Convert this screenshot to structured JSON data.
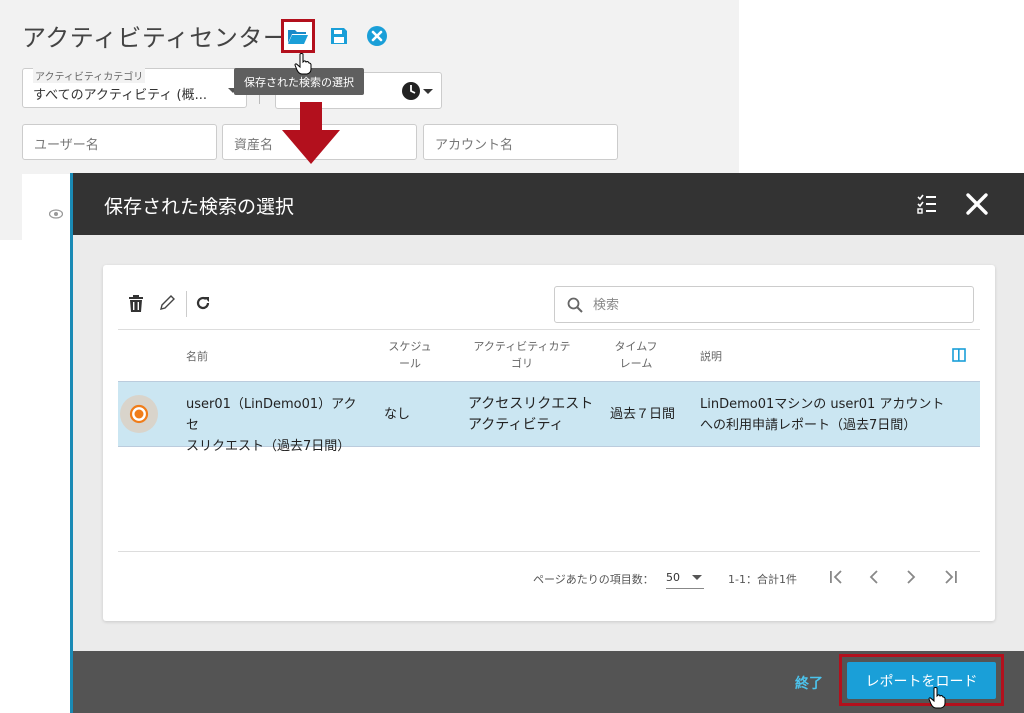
{
  "page": {
    "title": "アクティビティセンター",
    "tooltip": "保存された検索の選択",
    "category_select": {
      "label": "アクティビティカテゴリ",
      "value": "すべてのアクティビティ (概..."
    },
    "filters": {
      "user_placeholder": "ユーザー名",
      "asset_placeholder": "資産名",
      "account_placeholder": "アカウント名"
    },
    "icons": {
      "open": "folder-open-icon",
      "save": "save-icon",
      "clear": "close-circle-icon",
      "time": "clock-icon"
    }
  },
  "modal": {
    "title": "保存された検索の選択",
    "search_placeholder": "検索",
    "columns": {
      "name": "名前",
      "schedule": [
        "スケジュ",
        "ール"
      ],
      "category": [
        "アクティビティカテ",
        "ゴリ"
      ],
      "timeframe": [
        "タイムフ",
        "レーム"
      ],
      "description": "説明"
    },
    "rows": [
      {
        "name": [
          "user01（LinDemo01）アクセ",
          "スリクエスト（過去7日間）"
        ],
        "schedule": "なし",
        "category": [
          "アクセスリクエスト",
          "アクティビティ"
        ],
        "timeframe": "過去７日間",
        "description": [
          "LinDemo01マシンの user01 アカウント",
          "への利用申請レポート（過去7日間）"
        ],
        "selected": true
      }
    ],
    "pager": {
      "per_page_label": "ページあたりの項目数：",
      "per_page_value": "50",
      "range": "1-1：合計1件"
    },
    "footer": {
      "cancel_label": "終了",
      "load_label": "レポートをロード"
    }
  },
  "colors": {
    "accent": "#1a9fd8",
    "highlight_red": "#b3101d",
    "header_dark": "#333333",
    "row_selected": "#cbe6f2",
    "radio_orange": "#f07d1a"
  }
}
